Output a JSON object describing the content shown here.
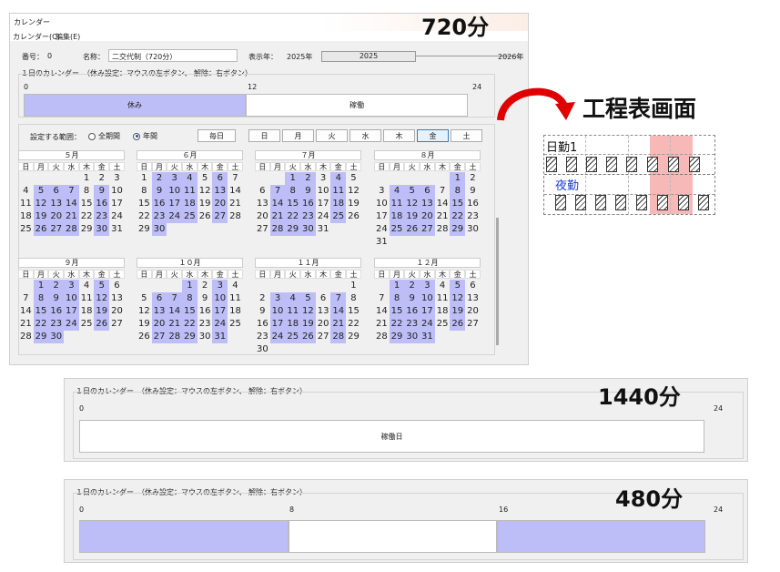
{
  "window": {
    "title": "カレンダー",
    "menu": [
      "カレンダー(C)",
      "編集(E)"
    ],
    "number_label": "番号：",
    "number_value": "0",
    "name_label": "名称：",
    "name_value": "二交代制（720分）",
    "year_label": "表示年：",
    "year_min": "2025年",
    "year_value": "2025",
    "year_max": "2026年",
    "day_calendar_label": "１日のカレンダー　（休み設定：マウスの左ボタン、 解除：右ボタン）",
    "scale": [
      "0",
      "12",
      "24"
    ],
    "bars": [
      {
        "label": "休み",
        "state": "off"
      },
      {
        "label": "稼働",
        "state": "on"
      }
    ],
    "range_label": "設定する範囲：",
    "range_options": [
      {
        "label": "全期間",
        "selected": false
      },
      {
        "label": "年間",
        "selected": true
      }
    ],
    "daily_button": "毎日",
    "weekday_buttons": [
      "日",
      "月",
      "火",
      "水",
      "木",
      "金",
      "土"
    ],
    "active_weekday": "金",
    "weekday_headers": [
      "日",
      "月",
      "火",
      "水",
      "木",
      "金",
      "土"
    ]
  },
  "months": [
    {
      "title": "５月",
      "start": 4,
      "days": 31,
      "holidays": [
        5,
        6,
        7,
        9,
        12,
        13,
        14,
        16,
        19,
        20,
        21,
        23,
        26,
        27,
        28,
        30
      ],
      "visible_days": 31
    },
    {
      "title": "６月",
      "start": 0,
      "days": 30,
      "holidays": [
        2,
        3,
        4,
        6,
        9,
        10,
        11,
        13,
        16,
        17,
        18,
        20,
        23,
        24,
        25,
        27,
        30
      ],
      "visible_days": 30
    },
    {
      "title": "７月",
      "start": 2,
      "days": 31,
      "holidays": [
        1,
        2,
        4,
        7,
        8,
        9,
        11,
        14,
        15,
        16,
        18,
        21,
        22,
        23,
        25,
        28,
        29,
        30
      ],
      "visible_days": 31
    },
    {
      "title": "８月",
      "start": 5,
      "days": 31,
      "holidays": [
        1,
        4,
        5,
        6,
        8,
        11,
        12,
        13,
        15,
        18,
        19,
        20,
        22,
        25,
        26,
        27,
        29
      ],
      "visible_days": 31
    },
    {
      "title": "９月",
      "start": 1,
      "days": 30,
      "holidays": [
        1,
        2,
        3,
        5,
        8,
        9,
        10,
        12,
        15,
        16,
        17,
        19,
        22,
        23,
        24,
        26,
        29,
        30
      ],
      "visible_days": 30
    },
    {
      "title": "１０月",
      "start": 3,
      "days": 31,
      "holidays": [
        1,
        3,
        6,
        7,
        8,
        10,
        13,
        14,
        15,
        17,
        20,
        21,
        22,
        24,
        27,
        28,
        29,
        31
      ],
      "visible_days": 31
    },
    {
      "title": "１１月",
      "start": 6,
      "days": 30,
      "holidays": [
        3,
        4,
        5,
        7,
        10,
        11,
        12,
        14,
        17,
        18,
        19,
        21,
        24,
        25,
        26,
        28
      ],
      "visible_days": 30
    },
    {
      "title": "１２月",
      "start": 1,
      "days": 31,
      "holidays": [
        1,
        2,
        3,
        5,
        8,
        9,
        10,
        12,
        15,
        16,
        17,
        19,
        22,
        23,
        24,
        26,
        29,
        30,
        31
      ],
      "visible_days": 31
    }
  ],
  "headings": {
    "m720": "720分",
    "m1440": "1440分",
    "m480": "480分",
    "schedule": "工程表画面"
  },
  "schedule": {
    "day_label": "日勤1",
    "night_label": "夜勤"
  },
  "panel1440": {
    "label": "１日のカレンダー　（休み設定：マウスの左ボタン、 解除：右ボタン）",
    "scale": [
      "0",
      "24"
    ],
    "bar": "稼働日"
  },
  "panel480": {
    "label": "１日のカレンダー　（休み設定：マウスの左ボタン、 解除：右ボタン）",
    "scale": [
      "0",
      "8",
      "16",
      "24"
    ]
  },
  "colors": {
    "holiday": "#bdbdf7",
    "arrow": "#e00000",
    "schedule_highlight": "#f7b8b8",
    "night_text": "#1f3fd0"
  }
}
